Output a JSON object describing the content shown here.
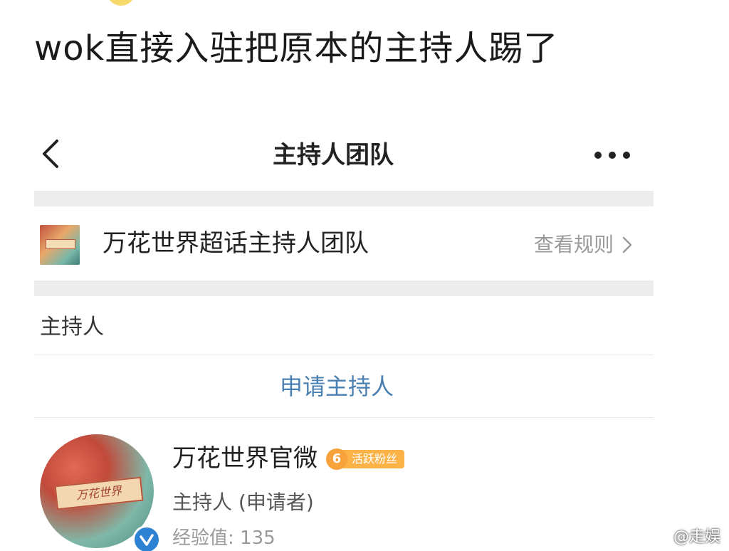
{
  "caption": "wok直接入驻把原本的主持人踢了",
  "nav": {
    "title": "主持人团队",
    "back_icon": "chevron-left-icon",
    "more_icon": "more-dots-icon"
  },
  "team": {
    "name": "万花世界超话主持人团队",
    "rules_label": "查看规则",
    "rules_icon": "chevron-right-icon"
  },
  "section": {
    "label": "主持人"
  },
  "apply_button": {
    "label": "申请主持人",
    "color": "#4a7fb2"
  },
  "host": {
    "name": "万花世界官微",
    "fan_level": "6",
    "fan_badge_text": "活跃粉丝",
    "role": "主持人 (申请者)",
    "exp": "经验值: 135",
    "avatar_text": "万花世界",
    "verified_icon": "verified-check-icon"
  },
  "watermark": {
    "text": "@走娱",
    "icon": "weibo-icon"
  }
}
